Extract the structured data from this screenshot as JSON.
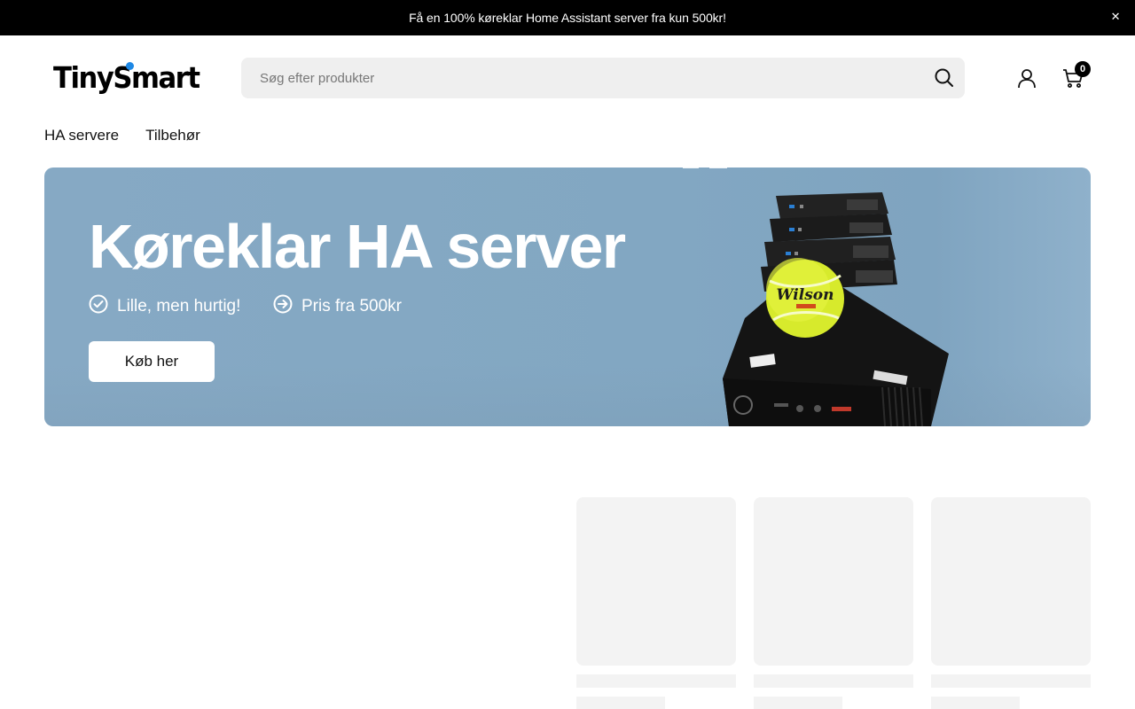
{
  "announcement": {
    "text": "Få en 100% køreklar Home Assistant server fra kun 500kr!",
    "close_icon": "close-icon"
  },
  "header": {
    "logo_text": "TinySmart",
    "search": {
      "placeholder": "Søg efter produkter",
      "value": ""
    },
    "cart_count": "0"
  },
  "nav": {
    "items": [
      {
        "label": "HA servere"
      },
      {
        "label": "Tilbehør"
      }
    ]
  },
  "hero": {
    "title": "Køreklar HA server",
    "features": [
      {
        "icon": "check-circle-icon",
        "label": "Lille, men hurtig!"
      },
      {
        "icon": "arrow-right-circle-icon",
        "label": "Pris fra 500kr"
      }
    ],
    "cta_label": "Køb her",
    "ball_text": "Wilson"
  },
  "colors": {
    "announcement_bg": "#000000",
    "hero_bg": "#84a8c3",
    "search_bg": "#efefef",
    "skeleton": "#f3f3f3",
    "logo_dot": "#1e88e5"
  }
}
